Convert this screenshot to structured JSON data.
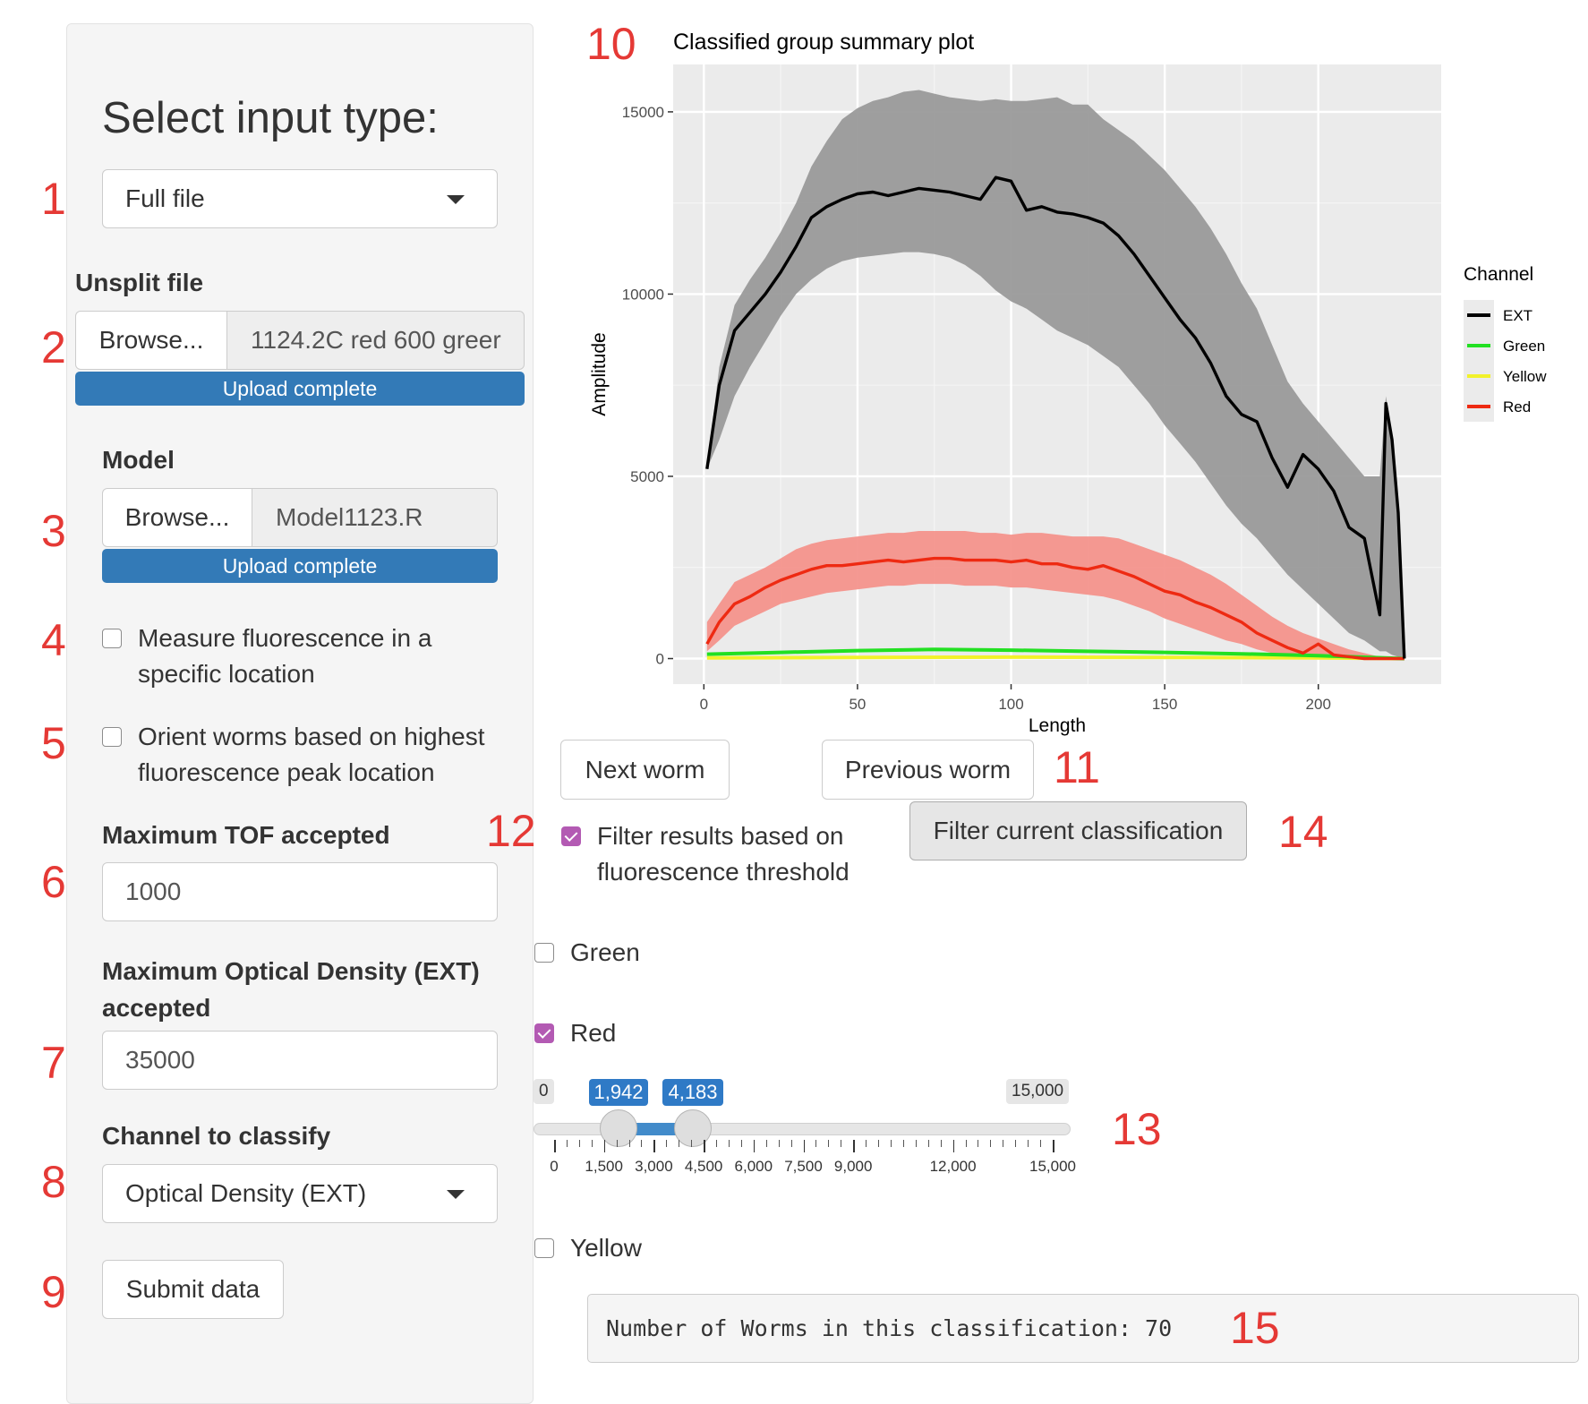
{
  "annotations": [
    "1",
    "2",
    "3",
    "4",
    "5",
    "6",
    "7",
    "8",
    "9",
    "10",
    "11",
    "12",
    "13",
    "14",
    "15"
  ],
  "sidebar": {
    "heading": "Select input type:",
    "input_type": {
      "value": "Full file"
    },
    "unsplit": {
      "label": "Unsplit file",
      "browse": "Browse...",
      "filename": "1124.2C red 600 greer",
      "progress": "Upload complete",
      "progress_fraction": 1.0
    },
    "model": {
      "label": "Model",
      "browse": "Browse...",
      "filename": "Model1123.R",
      "progress": "Upload complete",
      "progress_fraction": 1.0
    },
    "measure_fluor": {
      "line1": "Measure fluorescence in a",
      "line2": "specific location",
      "checked": false
    },
    "orient": {
      "line1": "Orient worms based on highest",
      "line2": "fluorescence peak location",
      "checked": false
    },
    "max_tof": {
      "label": "Maximum TOF accepted",
      "value": "1000"
    },
    "max_ext": {
      "line1": "Maximum Optical Density (EXT)",
      "line2": "accepted",
      "value": "35000"
    },
    "channel": {
      "label": "Channel to classify",
      "value": "Optical Density (EXT)"
    },
    "submit": "Submit data"
  },
  "plot": {
    "title": "Classified group summary plot",
    "xlabel": "Length",
    "ylabel": "Amplitude",
    "legend_title": "Channel",
    "legend": [
      {
        "name": "EXT",
        "color": "#000000"
      },
      {
        "name": "Green",
        "color": "#22e022"
      },
      {
        "name": "Yellow",
        "color": "#f2f22a"
      },
      {
        "name": "Red",
        "color": "#ee2a12"
      }
    ],
    "xticks": [
      "0",
      "50",
      "100",
      "150",
      "200"
    ],
    "yticks": [
      "0",
      "5000",
      "10000",
      "15000"
    ]
  },
  "chart_data": {
    "type": "line",
    "title": "Classified group summary plot",
    "xlabel": "Length",
    "ylabel": "Amplitude",
    "xlim": [
      -10,
      240
    ],
    "ylim": [
      -700,
      16300
    ],
    "grid": true,
    "legend_placement": "right",
    "series": [
      {
        "name": "EXT",
        "color": "#000000",
        "x": [
          1,
          5,
          10,
          15,
          20,
          25,
          30,
          35,
          40,
          45,
          50,
          55,
          60,
          65,
          70,
          75,
          80,
          85,
          90,
          95,
          100,
          105,
          110,
          115,
          120,
          125,
          130,
          135,
          140,
          145,
          150,
          155,
          160,
          165,
          170,
          175,
          180,
          185,
          190,
          195,
          200,
          205,
          210,
          215,
          220,
          222,
          224,
          226,
          228
        ],
        "y": [
          5200,
          7500,
          9000,
          9500,
          10000,
          10600,
          11300,
          12100,
          12400,
          12600,
          12750,
          12800,
          12700,
          12800,
          12900,
          12850,
          12800,
          12700,
          12600,
          13200,
          13100,
          12300,
          12400,
          12250,
          12200,
          12100,
          11950,
          11600,
          11100,
          10500,
          9900,
          9300,
          8800,
          8100,
          7200,
          6700,
          6500,
          5500,
          4700,
          5600,
          5200,
          4600,
          3600,
          3300,
          1200,
          7000,
          6000,
          4000,
          0
        ],
        "band_lo": [
          5200,
          6000,
          7200,
          8000,
          8700,
          9400,
          10000,
          10400,
          10700,
          10900,
          11000,
          11050,
          11100,
          11150,
          11150,
          11100,
          11000,
          10800,
          10500,
          10100,
          9800,
          9600,
          9300,
          9000,
          8800,
          8600,
          8300,
          8000,
          7500,
          7000,
          6400,
          5900,
          5400,
          4800,
          4200,
          3700,
          3300,
          2800,
          2300,
          1900,
          1500,
          1100,
          700,
          500,
          200,
          200,
          100,
          50,
          0
        ],
        "band_hi": [
          5200,
          8000,
          9700,
          10400,
          11000,
          11700,
          12500,
          13500,
          14200,
          14800,
          15100,
          15300,
          15400,
          15550,
          15600,
          15500,
          15400,
          15350,
          15300,
          15350,
          15300,
          15300,
          15350,
          15400,
          15200,
          15200,
          14800,
          14500,
          14200,
          13800,
          13400,
          12900,
          12400,
          11800,
          11100,
          10300,
          9600,
          8600,
          7600,
          7000,
          6500,
          6000,
          5500,
          5000,
          5000,
          7200,
          6200,
          4400,
          0
        ]
      },
      {
        "name": "Red",
        "color": "#ee2a12",
        "x": [
          1,
          5,
          10,
          15,
          20,
          25,
          30,
          35,
          40,
          45,
          50,
          55,
          60,
          65,
          70,
          75,
          80,
          85,
          90,
          95,
          100,
          105,
          110,
          115,
          120,
          125,
          130,
          135,
          140,
          145,
          150,
          155,
          160,
          165,
          170,
          175,
          180,
          185,
          190,
          195,
          200,
          205,
          210,
          215,
          220,
          228
        ],
        "y": [
          400,
          1000,
          1500,
          1700,
          1950,
          2150,
          2300,
          2450,
          2550,
          2550,
          2600,
          2650,
          2700,
          2650,
          2700,
          2750,
          2750,
          2700,
          2700,
          2700,
          2650,
          2700,
          2600,
          2600,
          2500,
          2450,
          2550,
          2400,
          2250,
          2050,
          1850,
          1750,
          1550,
          1400,
          1200,
          1000,
          700,
          500,
          300,
          150,
          400,
          100,
          50,
          0,
          0,
          0
        ],
        "band_lo": [
          200,
          500,
          900,
          1100,
          1300,
          1500,
          1600,
          1700,
          1800,
          1850,
          1900,
          1950,
          2000,
          2000,
          2050,
          2050,
          2050,
          2000,
          2000,
          2000,
          1950,
          1950,
          1900,
          1850,
          1800,
          1750,
          1700,
          1600,
          1450,
          1300,
          1100,
          950,
          800,
          650,
          500,
          400,
          250,
          150,
          80,
          30,
          50,
          20,
          10,
          0,
          0,
          0
        ],
        "band_hi": [
          1000,
          1500,
          2100,
          2300,
          2500,
          2750,
          3000,
          3150,
          3250,
          3300,
          3350,
          3400,
          3450,
          3450,
          3500,
          3500,
          3500,
          3500,
          3450,
          3450,
          3400,
          3450,
          3450,
          3400,
          3350,
          3350,
          3350,
          3300,
          3150,
          3000,
          2850,
          2700,
          2500,
          2300,
          2050,
          1750,
          1450,
          1150,
          900,
          700,
          550,
          400,
          250,
          150,
          50,
          0
        ]
      },
      {
        "name": "Green",
        "color": "#22e022",
        "x": [
          1,
          25,
          50,
          75,
          100,
          125,
          150,
          175,
          200,
          228
        ],
        "y": [
          120,
          170,
          220,
          250,
          230,
          200,
          170,
          130,
          80,
          0
        ]
      },
      {
        "name": "Yellow",
        "color": "#f2f22a",
        "x": [
          1,
          50,
          100,
          150,
          200,
          228
        ],
        "y": [
          20,
          30,
          40,
          30,
          20,
          0
        ]
      }
    ]
  },
  "nav": {
    "next": "Next worm",
    "previous": "Previous worm"
  },
  "filter": {
    "checkbox_line1": "Filter results based on",
    "checkbox_line2": "fluorescence threshold",
    "checked": true,
    "button": "Filter current classification"
  },
  "channels": [
    {
      "label": "Green",
      "checked": false
    },
    {
      "label": "Red",
      "checked": true
    },
    {
      "label": "Yellow",
      "checked": false
    }
  ],
  "slider": {
    "min_label": "0",
    "max_label": "15,000",
    "from_label": "1,942",
    "to_label": "4,183",
    "min": 0,
    "max": 15000,
    "from": 1942,
    "to": 4183,
    "ticks": [
      "0",
      "1,500",
      "3,000",
      "4,500",
      "6,000",
      "7,500",
      "9,000",
      "12,000",
      "15,000"
    ],
    "tick_values": [
      0,
      1500,
      3000,
      4500,
      6000,
      7500,
      9000,
      12000,
      15000
    ]
  },
  "output": {
    "text": "Number of Worms in this classification: 70"
  }
}
